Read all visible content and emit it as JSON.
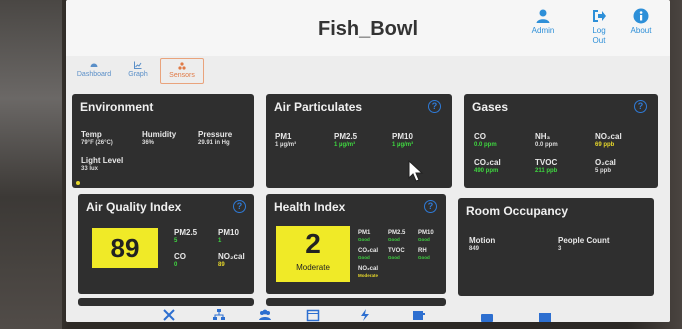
{
  "app": {
    "title": "Fish_Bowl"
  },
  "top_actions": [
    {
      "label": "Admin",
      "icon": "user-icon"
    },
    {
      "label": "Log Out",
      "icon": "logout-icon"
    },
    {
      "label": "About",
      "icon": "info-icon"
    }
  ],
  "nav": {
    "tabs": [
      {
        "label": "Dashboard",
        "icon": "dashboard-icon",
        "active": false
      },
      {
        "label": "Graph",
        "icon": "graph-icon",
        "active": false
      },
      {
        "label": "Sensors",
        "icon": "sensors-icon",
        "active": true
      }
    ]
  },
  "environment": {
    "title": "Environment",
    "temp": {
      "label": "Temp",
      "value": "79°F (26°C)"
    },
    "humidity": {
      "label": "Humidity",
      "value": "36%"
    },
    "pressure": {
      "label": "Pressure",
      "value": "29.91 in Hg"
    },
    "light": {
      "label": "Light Level",
      "value": "33 lux"
    }
  },
  "air_particulates": {
    "title": "Air Particulates",
    "help": "?",
    "pm1": {
      "label": "PM1",
      "value": "1 µg/m³"
    },
    "pm25": {
      "label": "PM2.5",
      "value": "1 µg/m³"
    },
    "pm10": {
      "label": "PM10",
      "value": "1 µg/m³"
    }
  },
  "gases": {
    "title": "Gases",
    "help": "?",
    "co": {
      "label": "CO",
      "value": "0.0 ppm"
    },
    "nh3": {
      "label": "NH₃",
      "value": "0.0 ppm"
    },
    "no2": {
      "label": "NO₂cal",
      "value": "69 ppb"
    },
    "co2": {
      "label": "CO₂cal",
      "value": "490 ppm"
    },
    "tvoc": {
      "label": "TVOC",
      "value": "211 ppb"
    },
    "o2": {
      "label": "O₂cal",
      "value": "5 ppb"
    }
  },
  "aqi": {
    "title": "Air Quality Index",
    "help": "?",
    "value": "89",
    "pm25": {
      "label": "PM2.5",
      "value": "5"
    },
    "pm10": {
      "label": "PM10",
      "value": "1"
    },
    "co": {
      "label": "CO",
      "value": "0"
    },
    "no2": {
      "label": "NO₂cal",
      "value": "89"
    }
  },
  "health": {
    "title": "Health Index",
    "help": "?",
    "value": "2",
    "status": "Moderate",
    "pm1": {
      "label": "PM1",
      "value": "Good"
    },
    "pm25": {
      "label": "PM2.5",
      "value": "Good"
    },
    "pm10": {
      "label": "PM10",
      "value": "Good"
    },
    "co": {
      "label": "CO₂cal",
      "value": "Good"
    },
    "tvoc": {
      "label": "TVOC",
      "value": "Good"
    },
    "rh": {
      "label": "RH",
      "value": "Good"
    },
    "no2": {
      "label": "NO₂cal",
      "value": "Moderate"
    }
  },
  "occupancy": {
    "title": "Room Occupancy",
    "motion": {
      "label": "Motion",
      "value": "849"
    },
    "people": {
      "label": "People Count",
      "value": "3"
    }
  },
  "bottom_icons": [
    "tools-icon",
    "network-icon",
    "users-icon",
    "calendar-icon",
    "power-icon",
    "export-icon",
    "camera-icon",
    "screen-icon"
  ],
  "colors": {
    "accent": "#2d8fd8",
    "panel": "#2f2f2f",
    "good": "#3fd640",
    "warn": "#e7d82b",
    "active_tab": "#e07a46"
  }
}
